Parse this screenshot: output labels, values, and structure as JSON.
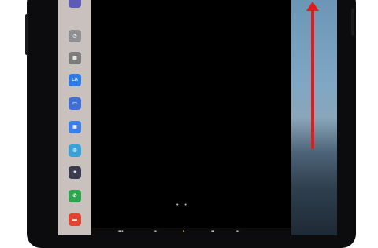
{
  "dock": {
    "apps": [
      {
        "name": "top-app-icon",
        "color": "#5d5ab8",
        "glyph": ""
      },
      {
        "name": "clock-app-icon",
        "color": "#8e8e93",
        "glyph": "◷"
      },
      {
        "name": "utilities-app-icon",
        "color": "#7c7c7c",
        "glyph": "▦"
      },
      {
        "name": "translate-app-icon",
        "color": "#2f7be6",
        "glyph": "LA"
      },
      {
        "name": "mail-app-icon",
        "color": "#3f6fd6",
        "glyph": "▭"
      },
      {
        "name": "files-app-icon",
        "color": "#3d7ee8",
        "glyph": "▣"
      },
      {
        "name": "safari-app-icon",
        "color": "#3aa1d8",
        "glyph": "◎"
      },
      {
        "name": "photos-app-icon",
        "color": "#3b3b4e",
        "glyph": "✦"
      },
      {
        "name": "phone-app-icon",
        "color": "#2ea44f",
        "glyph": "✆"
      },
      {
        "name": "red-app-icon",
        "color": "#e0432f",
        "glyph": "▬"
      }
    ]
  },
  "screen": {
    "page_dots": "• •"
  },
  "bottom_bar": {
    "items": [
      "▪▪▪",
      "▪▪",
      "▪",
      "▪▪",
      "▪▪"
    ]
  },
  "colors": {
    "arrow": "#e31b1b",
    "dock_bg": "#c8c1be",
    "screen_bg": "#000000"
  },
  "indicator": {
    "icon": "swipe-up-arrow"
  }
}
